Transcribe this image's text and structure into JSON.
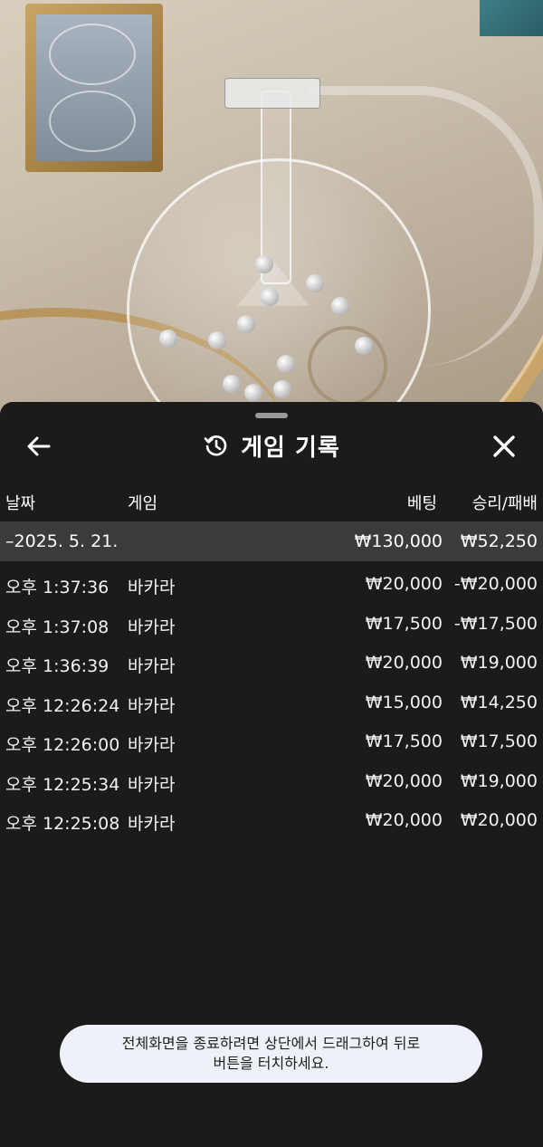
{
  "header": {
    "title": "게임 기록"
  },
  "columns": {
    "date": "날짜",
    "game": "게임",
    "bet": "베팅",
    "result": "승리/패배"
  },
  "summary": {
    "date": "–2025. 5. 21.",
    "bet": "₩130,000",
    "result": "₩52,250"
  },
  "rows": [
    {
      "time": "오후 1:37:36",
      "game": "바카라",
      "bet": "₩20,000",
      "result": "-₩20,000"
    },
    {
      "time": "오후 1:37:08",
      "game": "바카라",
      "bet": "₩17,500",
      "result": "-₩17,500"
    },
    {
      "time": "오후 1:36:39",
      "game": "바카라",
      "bet": "₩20,000",
      "result": "₩19,000"
    },
    {
      "time": "오후 12:26:24",
      "game": "바카라",
      "bet": "₩15,000",
      "result": "₩14,250"
    },
    {
      "time": "오후 12:26:00",
      "game": "바카라",
      "bet": "₩17,500",
      "result": "₩17,500"
    },
    {
      "time": "오후 12:25:34",
      "game": "바카라",
      "bet": "₩20,000",
      "result": "₩19,000"
    },
    {
      "time": "오후 12:25:08",
      "game": "바카라",
      "bet": "₩20,000",
      "result": "₩20,000"
    }
  ],
  "toast": {
    "line1": "전체화면을 종료하려면 상단에서 드래그하여 뒤로",
    "line2": "버튼을 터치하세요."
  },
  "icons": {
    "back": "arrow-left-icon",
    "history": "history-icon",
    "close": "close-icon"
  }
}
